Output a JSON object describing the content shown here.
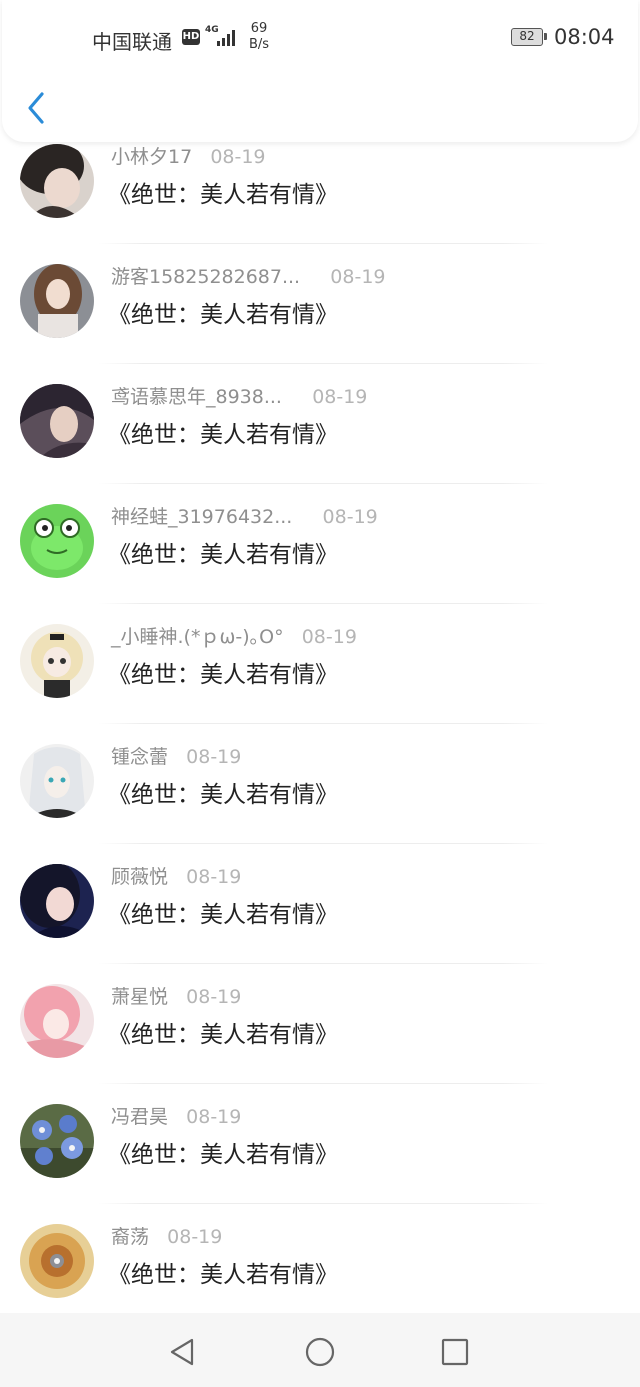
{
  "status_bar": {
    "carrier": "中国联通",
    "hd": "HD",
    "network": "4G",
    "speed_value": "69",
    "speed_unit": "B/s",
    "battery": "82",
    "time": "08:04"
  },
  "header": {
    "back_icon": "chevron-left-icon",
    "accent": "#2b8cd8"
  },
  "comments": [
    {
      "username": "小林夕17",
      "date": "08-19",
      "message": "《绝世：美人若有情》"
    },
    {
      "username": "游客15825282687...",
      "date": "08-19",
      "message": "《绝世：美人若有情》"
    },
    {
      "username": "鸢语慕思年_8938...",
      "date": "08-19",
      "message": "《绝世：美人若有情》"
    },
    {
      "username": "神经蛙_31976432...",
      "date": "08-19",
      "message": "《绝世：美人若有情》"
    },
    {
      "username": "_小睡神.(*ｐω-)｡O°",
      "date": "08-19",
      "message": "《绝世：美人若有情》"
    },
    {
      "username": "锺念蕾",
      "date": "08-19",
      "message": "《绝世：美人若有情》"
    },
    {
      "username": "顾薇悦",
      "date": "08-19",
      "message": "《绝世：美人若有情》"
    },
    {
      "username": "萧星悦",
      "date": "08-19",
      "message": "《绝世：美人若有情》"
    },
    {
      "username": "冯君昊",
      "date": "08-19",
      "message": "《绝世：美人若有情》"
    },
    {
      "username": "裔荡",
      "date": "08-19",
      "message": "《绝世：美人若有情》"
    }
  ],
  "nav_bar": {
    "icons": [
      "back-triangle-icon",
      "home-circle-icon",
      "recents-square-icon"
    ]
  }
}
